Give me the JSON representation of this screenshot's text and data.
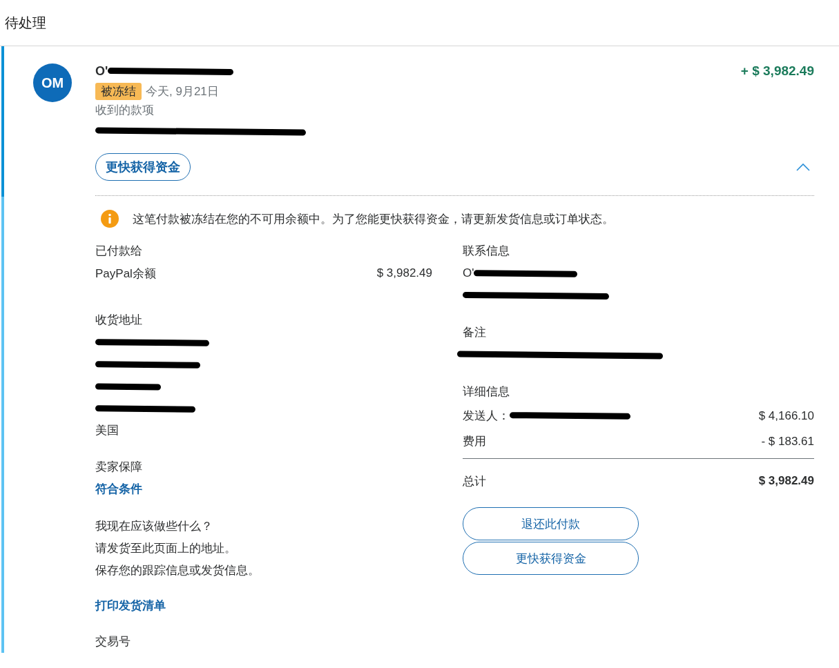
{
  "section_title": "待处理",
  "transaction": {
    "avatar_initials": "OM",
    "name": {
      "text": "O'",
      "redacted": true
    },
    "status": {
      "label": "被冻结",
      "kind": "on_hold"
    },
    "date": "今天, 9月21日",
    "type": "收到的款项",
    "note": {
      "redacted": true
    },
    "amount": "+ $ 3,982.49",
    "primary_action": "更快获得资金",
    "expanded": true
  },
  "notice": "这笔付款被冻结在您的不可用余额中。为了您能更快获得资金，请更新发货信息或订单状态。",
  "paid_to": {
    "heading": "已付款给",
    "method": "PayPal余额",
    "amount": "$ 3,982.49"
  },
  "shipping_address": {
    "heading": "收货地址",
    "lines": [
      {
        "redacted": true
      },
      {
        "redacted": true
      },
      {
        "redacted": true
      },
      {
        "redacted": true
      },
      {
        "text": "美国",
        "redacted": false
      }
    ]
  },
  "seller_protection": {
    "heading": "卖家保障",
    "value": "符合条件"
  },
  "next_steps": {
    "heading": "我现在应该做些什么？",
    "lines": [
      "请发货至此页面上的地址。",
      "保存您的跟踪信息或发货信息。"
    ]
  },
  "print_link": "打印发货清单",
  "transaction_id_heading": "交易号",
  "contact": {
    "heading": "联系信息",
    "name": {
      "text": "O'",
      "redacted": true
    },
    "email": {
      "redacted": true
    }
  },
  "memo": {
    "heading": "备注",
    "value": {
      "redacted": true
    }
  },
  "details": {
    "heading": "详细信息",
    "rows": [
      {
        "label": "发送人：",
        "value": {
          "redacted": true
        },
        "amount": "$ 4,166.10"
      },
      {
        "label": "费用",
        "amount": "- $ 183.61"
      }
    ],
    "total_label": "总计",
    "total": "$ 3,982.49"
  },
  "actions": [
    "退还此付款",
    "更快获得资金"
  ]
}
